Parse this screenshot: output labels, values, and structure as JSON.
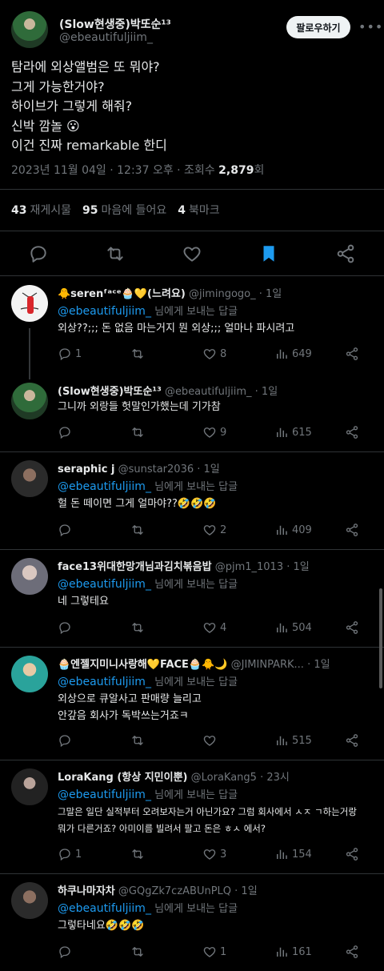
{
  "main": {
    "name": "(Slow현생중)박또순¹³",
    "handle": "@ebeautifuljiim_",
    "follow_label": "팔로우하기",
    "more": "•••",
    "lines": [
      "탐라에 외상앨범은 또 뭐야?",
      "그게 가능한거야?",
      "하이브가 그렇게 해줘?",
      "신박 깜놀 😮",
      "이건 진짜 remarkable 한디"
    ],
    "meta_prefix": "2023년 11월 04일 · 12:37 오후 · 조회수 ",
    "views": "2,879",
    "meta_suffix": "회",
    "retweets_count": "43",
    "retweets_label": "재게시물",
    "likes_count": "95",
    "likes_label": "마음에 들어요",
    "bookmarks_count": "4",
    "bookmarks_label": "북마크"
  },
  "colors": {
    "accent": "#1d9bf0",
    "text": "#e7e9ea",
    "muted": "#71767b",
    "border": "#2f3336"
  },
  "replying_suffix": "님에게 보내는 답글",
  "replies": [
    {
      "name": "🐥serenᶠᵃᶜᵉ🧁💛(느려요)",
      "handle": "@jimingogo_",
      "time": "· 1일",
      "mention": "@ebeautifuljiim_",
      "show_replying": true,
      "lines": [
        "외상??;;; 돈 없음 마는거지 뭔 외상;;; 얼마나 파시려고"
      ],
      "replies": "1",
      "retweets": "",
      "likes": "8",
      "views": "649"
    },
    {
      "name": "(Slow현생중)박또순¹³",
      "handle": "@ebeautifuljiim_",
      "time": "· 1일",
      "mention": "",
      "show_replying": false,
      "lines": [
        "그니까 외랑들 헛말인가했는데 기가참"
      ],
      "replies": "",
      "retweets": "",
      "likes": "9",
      "views": "615"
    },
    {
      "name": "seraphic j",
      "handle": "@sunstar2036",
      "time": "· 1일",
      "mention": "@ebeautifuljiim_",
      "show_replying": true,
      "lines": [
        "헐 돈 떼이면 그게 얼마야??🤣🤣🤣"
      ],
      "replies": "",
      "retweets": "",
      "likes": "2",
      "views": "409"
    },
    {
      "name": "face13위대한망개님과김치볶음밥",
      "handle": "@pjm1_1013",
      "time": "· 1일",
      "mention": "@ebeautifuljiim_",
      "show_replying": true,
      "lines": [
        "네 그렇테요"
      ],
      "replies": "",
      "retweets": "",
      "likes": "4",
      "views": "504"
    },
    {
      "name": "🧁엔젤지미니사랑해💛FACE🧁🐥🌙",
      "handle": "@JIMINPARK...",
      "time": "· 1일",
      "mention": "@ebeautifuljiim_",
      "show_replying": true,
      "lines": [
        "외상으로 큐알사고 판매량 늘리고",
        "안갚음 회사가 독박쓰는거죠ㅋ"
      ],
      "replies": "",
      "retweets": "",
      "likes": "",
      "views": "515"
    },
    {
      "name": "LoraKang (항상 지민이뿐)",
      "handle": "@LoraKang5",
      "time": "· 23시",
      "mention": "@ebeautifuljiim_",
      "show_replying": true,
      "lines": [
        "그말은 일단 실적부터 오려보자는거 아닌가요? 그럼 회사에서 ㅅㅈ ㄱ하는거랑",
        "뭐가 다른거죠? 아미이름 빌려서 팔고 돈은 ㅎㅅ 에서?"
      ],
      "replies": "1",
      "retweets": "",
      "likes": "3",
      "views": "154"
    },
    {
      "name": "하쿠나마자차",
      "handle": "@GQgZk7czABUnPLQ",
      "time": "· 1일",
      "mention": "@ebeautifuljiim_",
      "show_replying": true,
      "lines": [
        "그렇타네요🤣🤣🤣"
      ],
      "replies": "",
      "retweets": "",
      "likes": "1",
      "views": "161"
    }
  ]
}
